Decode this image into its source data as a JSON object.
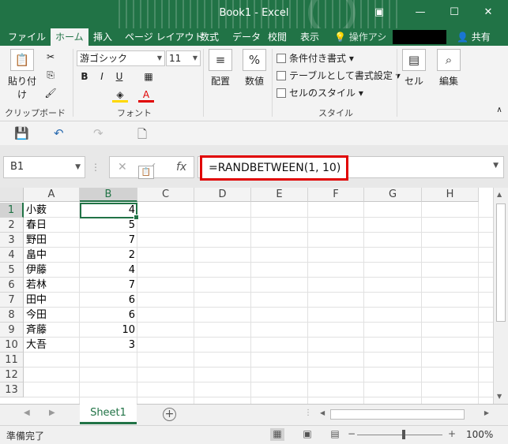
{
  "window": {
    "title": "Book1 - Excel"
  },
  "tabs": [
    "ファイル",
    "ホーム",
    "挿入",
    "ページ レイアウト",
    "数式",
    "データ",
    "校閲",
    "表示"
  ],
  "active_tab": "ホーム",
  "tell_me": "操作アシ",
  "share": "共有",
  "ribbon": {
    "clipboard": {
      "paste": "貼り付け",
      "label": "クリップボード"
    },
    "font": {
      "name": "游ゴシック",
      "size": "11",
      "label": "フォント",
      "bold": "B",
      "italic": "I",
      "underline": "U"
    },
    "alignment": {
      "label": "配置"
    },
    "number": {
      "label": "数値",
      "icon": "%"
    },
    "styles": {
      "conditional": "条件付き書式",
      "table": "テーブルとして書式設定",
      "cell_styles": "セルのスタイル",
      "label": "スタイル"
    },
    "cells": {
      "label": "セル"
    },
    "editing": {
      "label": "編集"
    }
  },
  "formula_bar": {
    "name_box": "B1",
    "formula": "=RANDBETWEEN(1, 10)",
    "fx": "fx"
  },
  "columns": [
    "A",
    "B",
    "C",
    "D",
    "E",
    "F",
    "G",
    "H"
  ],
  "rows": [
    {
      "num": "1",
      "name": "小薮",
      "value": "4"
    },
    {
      "num": "2",
      "name": "春日",
      "value": "5"
    },
    {
      "num": "3",
      "name": "野田",
      "value": "7"
    },
    {
      "num": "4",
      "name": "畠中",
      "value": "2"
    },
    {
      "num": "5",
      "name": "伊藤",
      "value": "4"
    },
    {
      "num": "6",
      "name": "若林",
      "value": "7"
    },
    {
      "num": "7",
      "name": "田中",
      "value": "6"
    },
    {
      "num": "8",
      "name": "今田",
      "value": "6"
    },
    {
      "num": "9",
      "name": "斉藤",
      "value": "10"
    },
    {
      "num": "10",
      "name": "大吾",
      "value": "3"
    },
    {
      "num": "11",
      "name": "",
      "value": ""
    },
    {
      "num": "12",
      "name": "",
      "value": ""
    },
    {
      "num": "13",
      "name": "",
      "value": ""
    }
  ],
  "sheet": {
    "tab": "Sheet1"
  },
  "status": {
    "text": "準備完了",
    "zoom": "100%"
  },
  "colors": {
    "accent": "#217346",
    "highlight": "#e00000"
  }
}
